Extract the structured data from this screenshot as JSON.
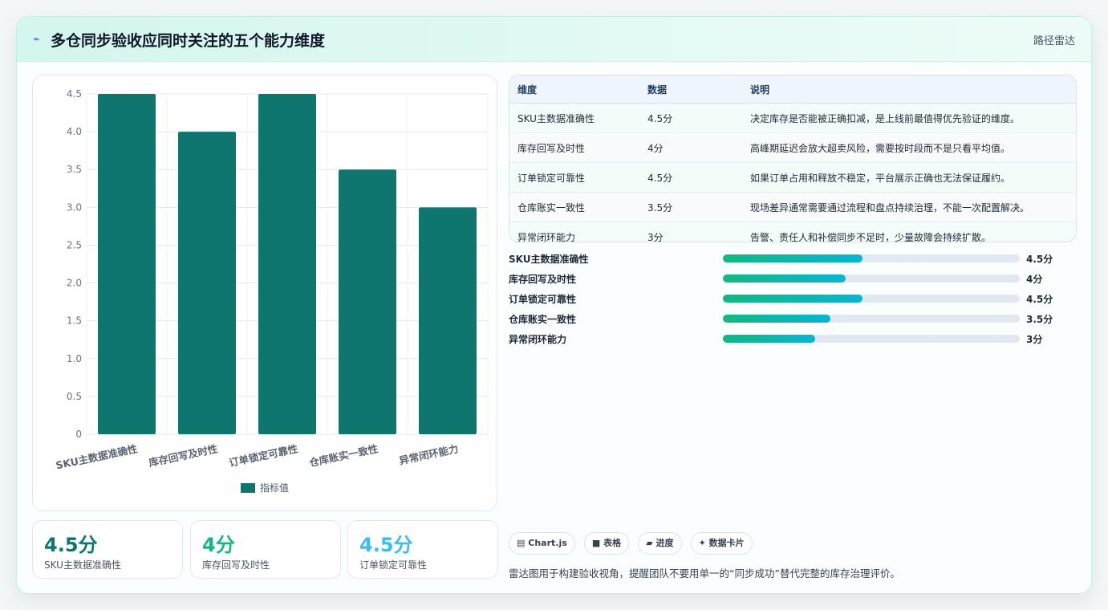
{
  "header": {
    "icon": "pulse-icon",
    "title": "多仓同步验收应同时关注的五个能力维度",
    "tag": "路径雷达"
  },
  "chart_data": {
    "type": "bar",
    "categories": [
      "SKU主数据准确性",
      "库存回写及时性",
      "订单锁定可靠性",
      "仓库账实一致性",
      "异常闭环能力"
    ],
    "series": [
      {
        "name": "指标值",
        "values": [
          4.5,
          4,
          4.5,
          3.5,
          3
        ],
        "color": "#0f766e"
      }
    ],
    "ylim": [
      0,
      4.5
    ],
    "yticks": [
      "0",
      "0.5",
      "1.0",
      "1.5",
      "2.0",
      "2.5",
      "3.0",
      "3.5",
      "4.0",
      "4.5"
    ],
    "grid": true,
    "legend_position": "bottom"
  },
  "kpis": [
    {
      "value": "4.5分",
      "label": "SKU主数据准确性",
      "color": "#0f766e"
    },
    {
      "value": "4分",
      "label": "库存回写及时性",
      "color": "#10b981"
    },
    {
      "value": "4.5分",
      "label": "订单锁定可靠性",
      "color": "#38bdf8"
    }
  ],
  "table": {
    "headers": [
      "维度",
      "数据",
      "说明"
    ],
    "rows": [
      [
        "SKU主数据准确性",
        "4.5分",
        "决定库存是否能被正确扣减，是上线前最值得优先验证的维度。"
      ],
      [
        "库存回写及时性",
        "4分",
        "高峰期延迟会放大超卖风险，需要按时段而不是只看平均值。"
      ],
      [
        "订单锁定可靠性",
        "4.5分",
        "如果订单占用和释放不稳定，平台展示正确也无法保证履约。"
      ],
      [
        "仓库账实一致性",
        "3.5分",
        "现场差异通常需要通过流程和盘点持续治理，不能一次配置解决。"
      ],
      [
        "异常闭环能力",
        "3分",
        "告警、责任人和补偿同步不足时，少量故障会持续扩散。"
      ]
    ]
  },
  "progress": [
    {
      "label": "SKU主数据准确性",
      "value": "4.5分",
      "fraction": 0.47
    },
    {
      "label": "库存回写及时性",
      "value": "4分",
      "fraction": 0.414
    },
    {
      "label": "订单锁定可靠性",
      "value": "4.5分",
      "fraction": 0.47
    },
    {
      "label": "仓库账实一致性",
      "value": "3.5分",
      "fraction": 0.362
    },
    {
      "label": "异常闭环能力",
      "value": "3分",
      "fraction": 0.31
    }
  ],
  "chips": [
    {
      "icon": "chart-icon",
      "glyph": "▤",
      "label": "Chart.js"
    },
    {
      "icon": "table-icon",
      "glyph": "■",
      "label": "表格"
    },
    {
      "icon": "progress-icon",
      "glyph": "▰",
      "label": "进度"
    },
    {
      "icon": "card-icon",
      "glyph": "✦",
      "label": "数据卡片"
    }
  ],
  "note": "雷达图用于构建验收视角，提醒团队不要用单一的“同步成功”替代完整的库存治理评价。"
}
